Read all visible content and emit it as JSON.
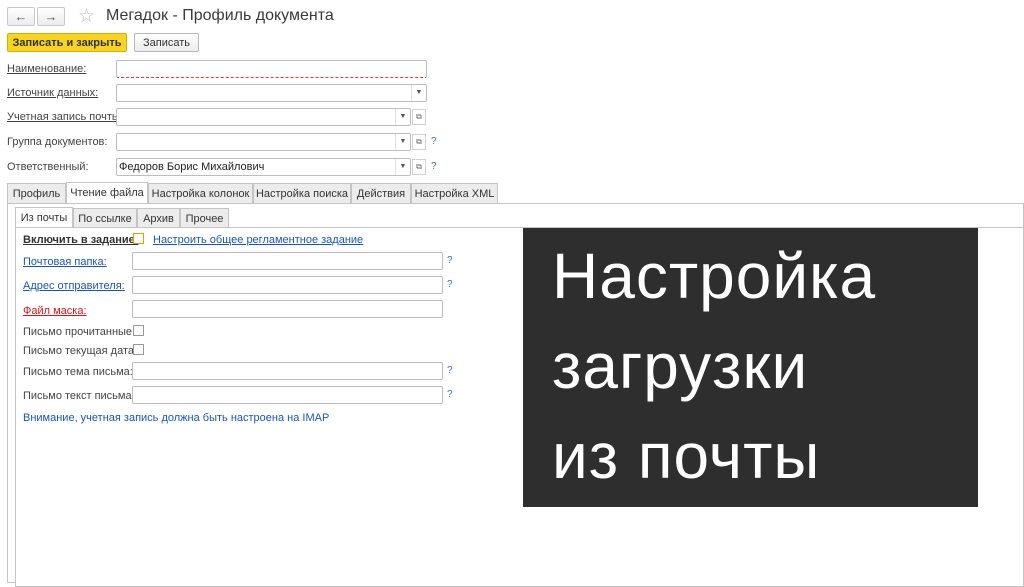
{
  "window": {
    "title": "Мегадок - Профиль документа",
    "back_icon": "←",
    "forward_icon": "→",
    "star_icon": "☆"
  },
  "toolbar": {
    "save_close_label": "Записать и закрыть",
    "save_label": "Записать"
  },
  "form": {
    "name_label": "Наименование:",
    "name_value": "",
    "source_label": "Источник данных:",
    "source_value": "",
    "mail_account_label": "Учетная запись почты:",
    "mail_account_value": "",
    "doc_group_label": "Группа документов:",
    "doc_group_value": "",
    "responsible_label": "Ответственный:",
    "responsible_value": "Федоров Борис Михайлович",
    "help_mark": "?"
  },
  "tabs": [
    "Профиль",
    "Чтение файла",
    "Настройка колонок",
    "Настройка поиска",
    "Действия",
    "Настройка XML"
  ],
  "subtabs": [
    "Из почты",
    "По ссылке",
    "Архив",
    "Прочее"
  ],
  "mail_settings": {
    "include_label": "Включить в задание:",
    "include_checked": false,
    "schedule_link": "Настроить общее регламентное задание",
    "folder_label": "Почтовая папка:",
    "folder_value": "",
    "sender_label": "Адрес отправителя:",
    "sender_value": "",
    "mask_label": "Файл маска:",
    "mask_value": "",
    "read_label": "Письмо прочитанные:",
    "read_checked": false,
    "current_date_label": "Письмо текущая дата:",
    "current_date_checked": false,
    "subject_label": "Письмо тема письма:",
    "subject_value": "",
    "body_label": "Письмо текст письма:",
    "body_value": "",
    "note": "Внимание, учетная запись должна быть настроена на IMAP"
  },
  "overlay": {
    "line1": "Настройка",
    "line2": "загрузки",
    "line3": "из почты"
  },
  "colors": {
    "primary_button": "#f7d324",
    "link": "#1a56b8",
    "required": "#d01818",
    "overlay_bg": "#2e2e2e"
  }
}
